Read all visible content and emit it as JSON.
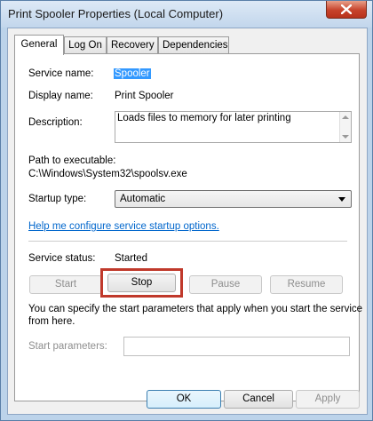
{
  "window": {
    "title": "Print Spooler Properties (Local Computer)"
  },
  "tabs": [
    {
      "label": "General"
    },
    {
      "label": "Log On"
    },
    {
      "label": "Recovery"
    },
    {
      "label": "Dependencies"
    }
  ],
  "general": {
    "service_name_label": "Service name:",
    "service_name_value": "Spooler",
    "display_name_label": "Display name:",
    "display_name_value": "Print Spooler",
    "description_label": "Description:",
    "description_value": "Loads files to memory for later printing",
    "path_label": "Path to executable:",
    "path_value": "C:\\Windows\\System32\\spoolsv.exe",
    "startup_type_label": "Startup type:",
    "startup_type_value": "Automatic",
    "help_link": "Help me configure service startup options.",
    "status_label": "Service status:",
    "status_value": "Started",
    "buttons": {
      "start": "Start",
      "stop": "Stop",
      "pause": "Pause",
      "resume": "Resume"
    },
    "start_params_info_line1": "You can specify the start parameters that apply when you start the service",
    "start_params_info_line2": "from here.",
    "start_params_label": "Start parameters:",
    "start_params_value": ""
  },
  "footer": {
    "ok": "OK",
    "cancel": "Cancel",
    "apply": "Apply"
  },
  "colors": {
    "highlight_box": "#c0392b",
    "link": "#0066cc",
    "selection": "#3399ff"
  },
  "icons": {
    "close": "close-icon"
  }
}
